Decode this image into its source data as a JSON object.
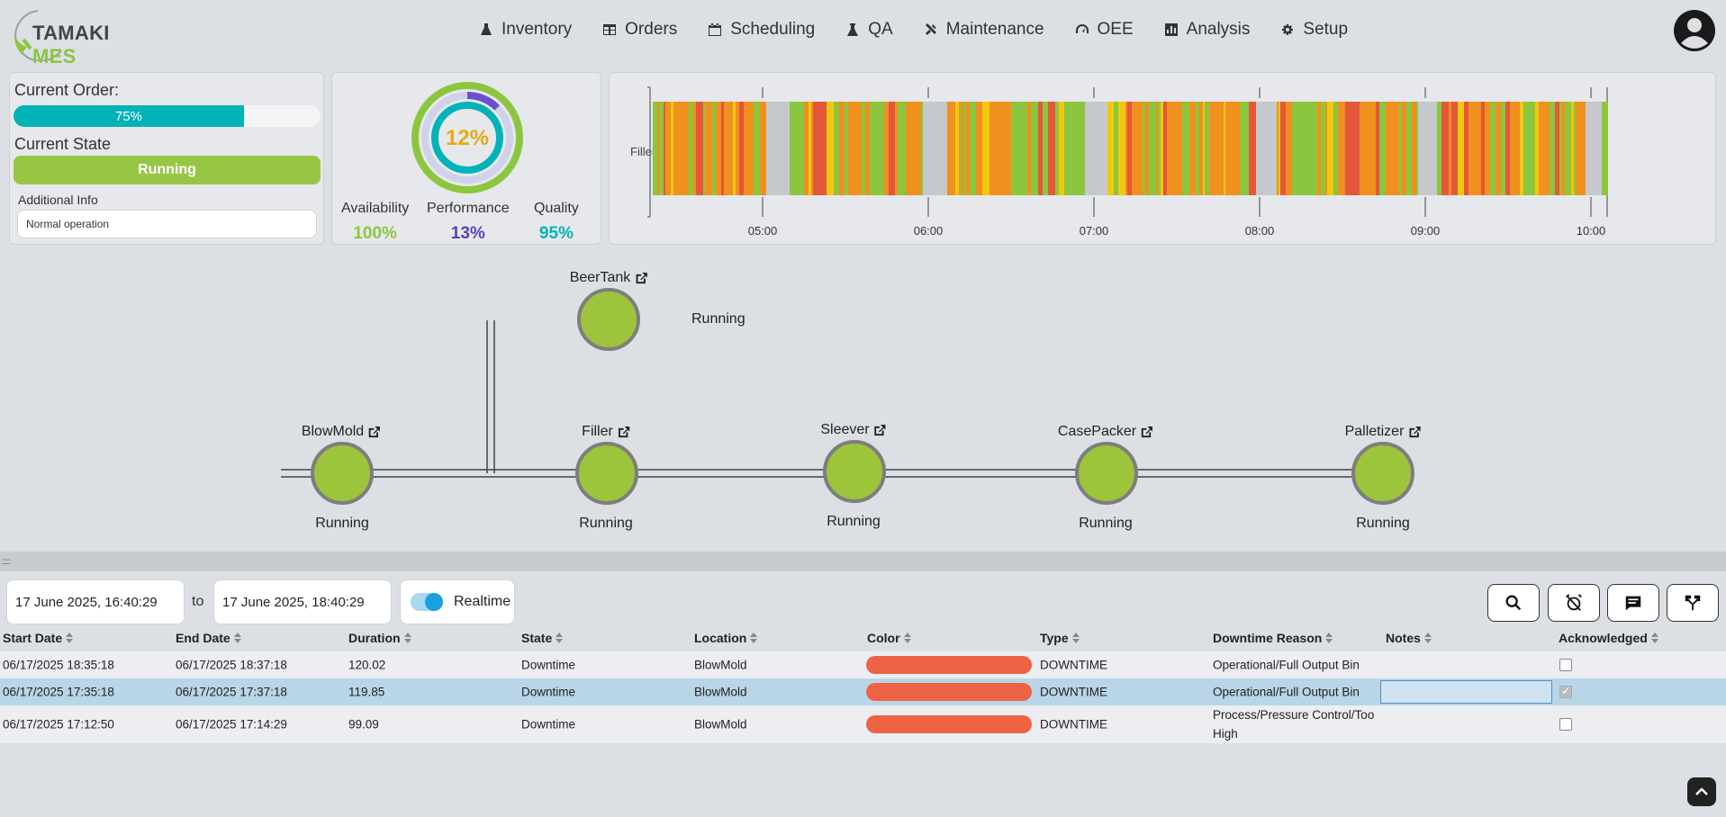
{
  "brand": {
    "name_a": "TAMAKI",
    "name_b": "MES"
  },
  "nav": [
    {
      "label": "Inventory",
      "icon": "flask-icon"
    },
    {
      "label": "Orders",
      "icon": "table-icon"
    },
    {
      "label": "Scheduling",
      "icon": "calendar-icon"
    },
    {
      "label": "QA",
      "icon": "beaker-icon"
    },
    {
      "label": "Maintenance",
      "icon": "tools-icon"
    },
    {
      "label": "OEE",
      "icon": "speedometer-icon"
    },
    {
      "label": "Analysis",
      "icon": "chart-icon"
    },
    {
      "label": "Setup",
      "icon": "gear-icon"
    }
  ],
  "order": {
    "current_order_label": "Current Order:",
    "progress_text": "75%",
    "progress_fraction": 0.75,
    "current_state_label": "Current State",
    "state_text": "Running",
    "additional_info_label": "Additional Info",
    "additional_info_value": "Normal operation"
  },
  "oee": {
    "overall": "12%",
    "availability_label": "Availability",
    "availability_value": "100%",
    "performance_label": "Performance",
    "performance_value": "13%",
    "quality_label": "Quality",
    "quality_value": "95%",
    "colors": {
      "availability": "#8cc63f",
      "performance": "#6a4fd0",
      "quality": "#00b3b8",
      "overall": "#e6a817"
    }
  },
  "timeline": {
    "machine": "Filler",
    "ticks": [
      "05:00",
      "06:00",
      "07:00",
      "08:00",
      "09:00",
      "10:00"
    ],
    "colors": {
      "running": "#8cc63f",
      "idle": "#f2c80f",
      "warn": "#f0901e",
      "down": "#e4573a",
      "off": "#c5c9ce"
    }
  },
  "flow": {
    "nodes": [
      {
        "title": "BeerTank",
        "state": "Running"
      },
      {
        "title": "BlowMold",
        "state": "Running"
      },
      {
        "title": "Filler",
        "state": "Running"
      },
      {
        "title": "Sleever",
        "state": "Running"
      },
      {
        "title": "CasePacker",
        "state": "Running"
      },
      {
        "title": "Palletizer",
        "state": "Running"
      }
    ]
  },
  "filters": {
    "from": "17 June 2025, 16:40:29",
    "to_label": "to",
    "to": "17 June 2025, 18:40:29",
    "realtime_label": "Realtime",
    "realtime_on": true
  },
  "table": {
    "headers": [
      "Start Date",
      "End Date",
      "Duration",
      "State",
      "Location",
      "Color",
      "Type",
      "Downtime Reason",
      "Notes",
      "Acknowledged"
    ],
    "rows": [
      {
        "start": "06/17/2025 18:35:18",
        "end": "06/17/2025 18:37:18",
        "duration": "120.02",
        "state": "Downtime",
        "location": "BlowMold",
        "color": "#ee6344",
        "type": "DOWNTIME",
        "reason": "Operational/Full Output Bin",
        "notes": "",
        "ack": false
      },
      {
        "start": "06/17/2025 17:35:18",
        "end": "06/17/2025 17:37:18",
        "duration": "119.85",
        "state": "Downtime",
        "location": "BlowMold",
        "color": "#ee6344",
        "type": "DOWNTIME",
        "reason": "Operational/Full Output Bin",
        "notes": "",
        "ack": true
      },
      {
        "start": "06/17/2025 17:12:50",
        "end": "06/17/2025 17:14:29",
        "duration": "99.09",
        "state": "Downtime",
        "location": "BlowMold",
        "color": "#ee6344",
        "type": "DOWNTIME",
        "reason": "Process/Pressure Control/Too High",
        "notes": "",
        "ack": false
      }
    ]
  }
}
